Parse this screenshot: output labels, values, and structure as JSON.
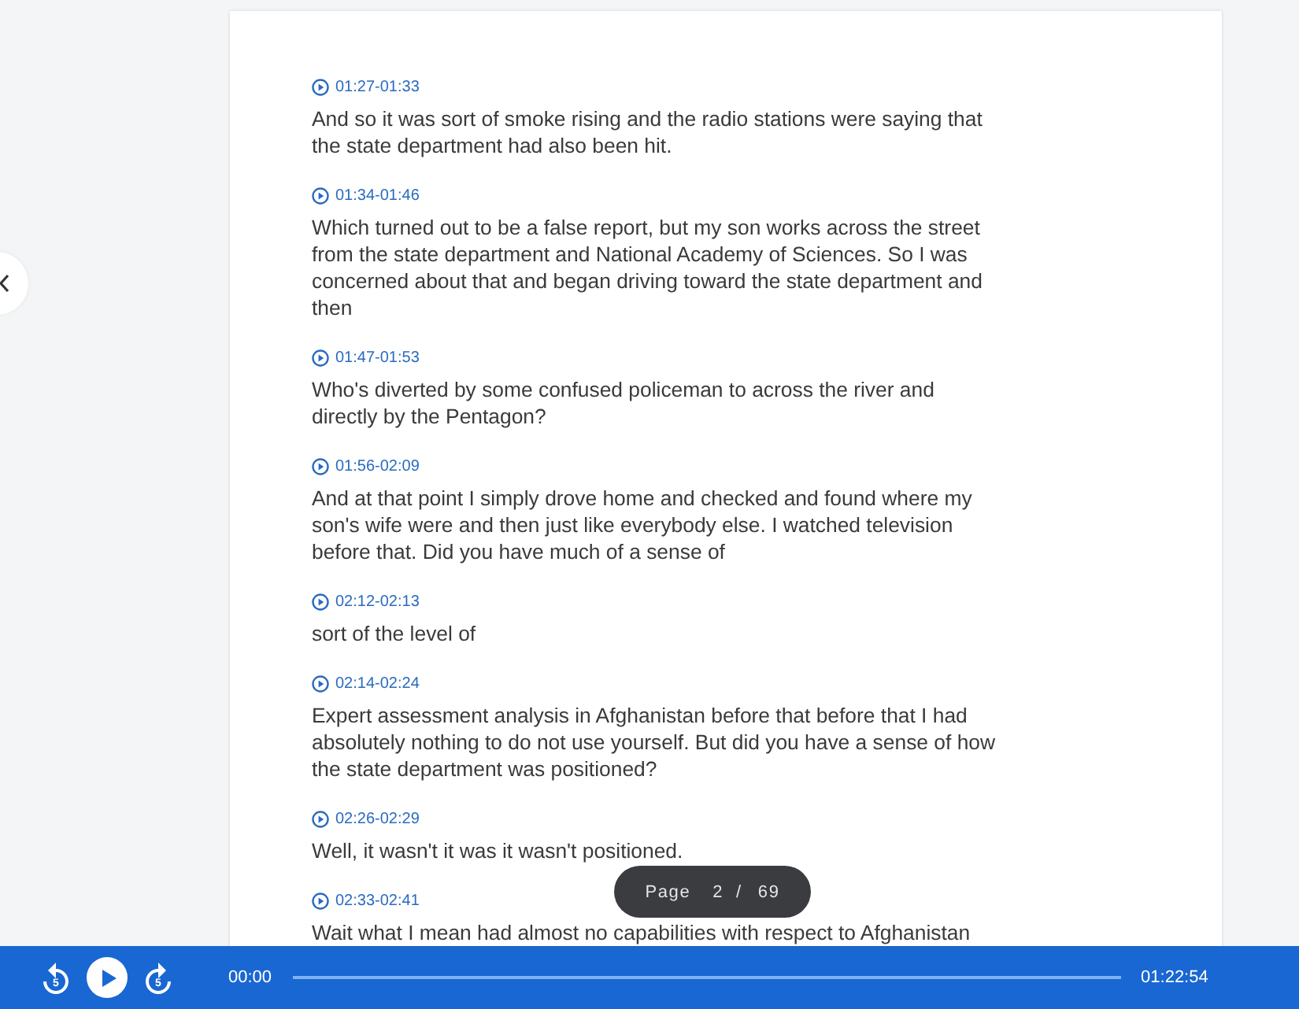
{
  "transcript": {
    "segments": [
      {
        "time": "01:27-01:33",
        "text": "And so it was sort of smoke rising and the radio stations were saying that the state department had also been hit."
      },
      {
        "time": "01:34-01:46",
        "text": "Which turned out to be a false report, but my son works across the street from the state department and National Academy of Sciences. So I was concerned about that and began driving toward the state department and then"
      },
      {
        "time": "01:47-01:53",
        "text": "Who's diverted by some confused policeman to across the river and directly by the Pentagon?"
      },
      {
        "time": "01:56-02:09",
        "text": "And at that point I simply drove home and checked and found where my son's wife were and then just like everybody else. I watched television before that. Did you have much of a sense of"
      },
      {
        "time": "02:12-02:13",
        "text": "sort of the level of"
      },
      {
        "time": "02:14-02:24",
        "text": "Expert assessment analysis in Afghanistan before that before that I had absolutely nothing to do not use yourself. But did you have a sense of how the state department was positioned?"
      },
      {
        "time": "02:26-02:29",
        "text": "Well, it wasn't it was it wasn't positioned."
      },
      {
        "time": "02:33-02:41",
        "text": "Wait what I mean had almost no capabilities with respect to Afghanistan"
      }
    ]
  },
  "pager": {
    "label": "Page",
    "current": "2",
    "separator": "/",
    "total": "69"
  },
  "player": {
    "skip_back": "5",
    "skip_forward": "5",
    "playing": false,
    "elapsed": "00:00",
    "duration": "01:22:54",
    "level": 0
  }
}
